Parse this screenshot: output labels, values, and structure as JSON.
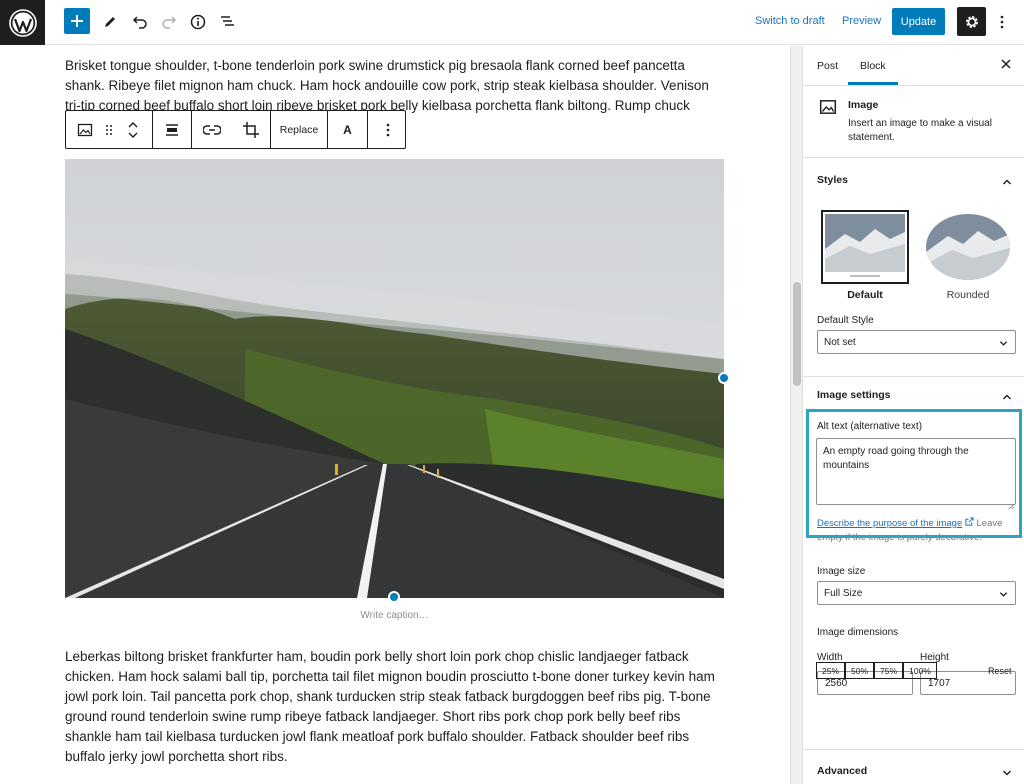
{
  "topbar": {
    "switch_to_draft": "Switch to draft",
    "preview": "Preview",
    "update": "Update"
  },
  "editor": {
    "paragraph_top": "Brisket tongue shoulder, t-bone tenderloin pork swine drumstick pig bresaola flank corned beef pancetta shank. Ribeye filet mignon ham chuck. Ham hock andouille cow pork, strip steak kielbasa shoulder. Venison tri-tip corned beef buffalo short loin ribeye brisket pork belly kielbasa porchetta flank biltong. Rump chuck",
    "toolbar_replace": "Replace",
    "toolbar_text": "A",
    "caption_placeholder": "Write caption…",
    "paragraph_bottom": "Leberkas biltong brisket frankfurter ham, boudin pork belly short loin pork chop chislic landjaeger fatback chicken. Ham hock salami ball tip, porchetta tail filet mignon boudin prosciutto t-bone doner turkey kevin ham jowl pork loin. Tail pancetta pork chop, shank turducken strip steak fatback burgdoggen beef ribs pig. T-bone ground round tenderloin swine rump ribeye fatback landjaeger. Short ribs pork chop pork belly beef ribs shankle ham tail kielbasa turducken jowl flank meatloaf pork buffalo shoulder. Fatback shoulder beef ribs buffalo jerky jowl porchetta short ribs."
  },
  "sidebar": {
    "tabs": [
      "Post",
      "Block"
    ],
    "block_name": "Image",
    "block_description": "Insert an image to make a visual statement.",
    "styles_title": "Styles",
    "style_default": "Default",
    "style_rounded": "Rounded",
    "default_style_label": "Default Style",
    "default_style_value": "Not set",
    "image_settings_title": "Image settings",
    "alt_label": "Alt text (alternative text)",
    "alt_value": "An empty road going through the mountains",
    "alt_help_link": "Describe the purpose of the image",
    "alt_help_rest": " Leave empty if the image is purely decorative.",
    "image_size_label": "Image size",
    "image_size_value": "Full Size",
    "dimensions_label": "Image dimensions",
    "width_label": "Width",
    "height_label": "Height",
    "width_value": "2560",
    "height_value": "1707",
    "percent_buttons": [
      "25%",
      "50%",
      "75%",
      "100%"
    ],
    "reset": "Reset",
    "advanced_title": "Advanced"
  },
  "colors": {
    "accent": "#007cba",
    "highlight": "#2fa3c6"
  }
}
